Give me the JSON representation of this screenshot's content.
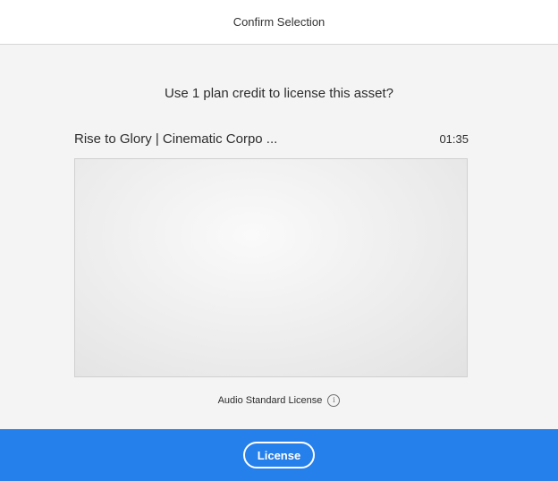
{
  "dialog": {
    "title": "Confirm Selection",
    "prompt": "Use 1 plan credit to license this asset?"
  },
  "asset": {
    "title": "Rise to Glory | Cinematic Corpo ...",
    "duration": "01:35",
    "preview_icon": "audio-waveform-icon",
    "license_type": "Audio Standard License",
    "info_icon": "info-icon"
  },
  "footer": {
    "license_button_label": "License"
  },
  "colors": {
    "accent": "#2680eb",
    "waveform_light": "#6d62cf",
    "waveform_dark": "#2a2a8a"
  }
}
